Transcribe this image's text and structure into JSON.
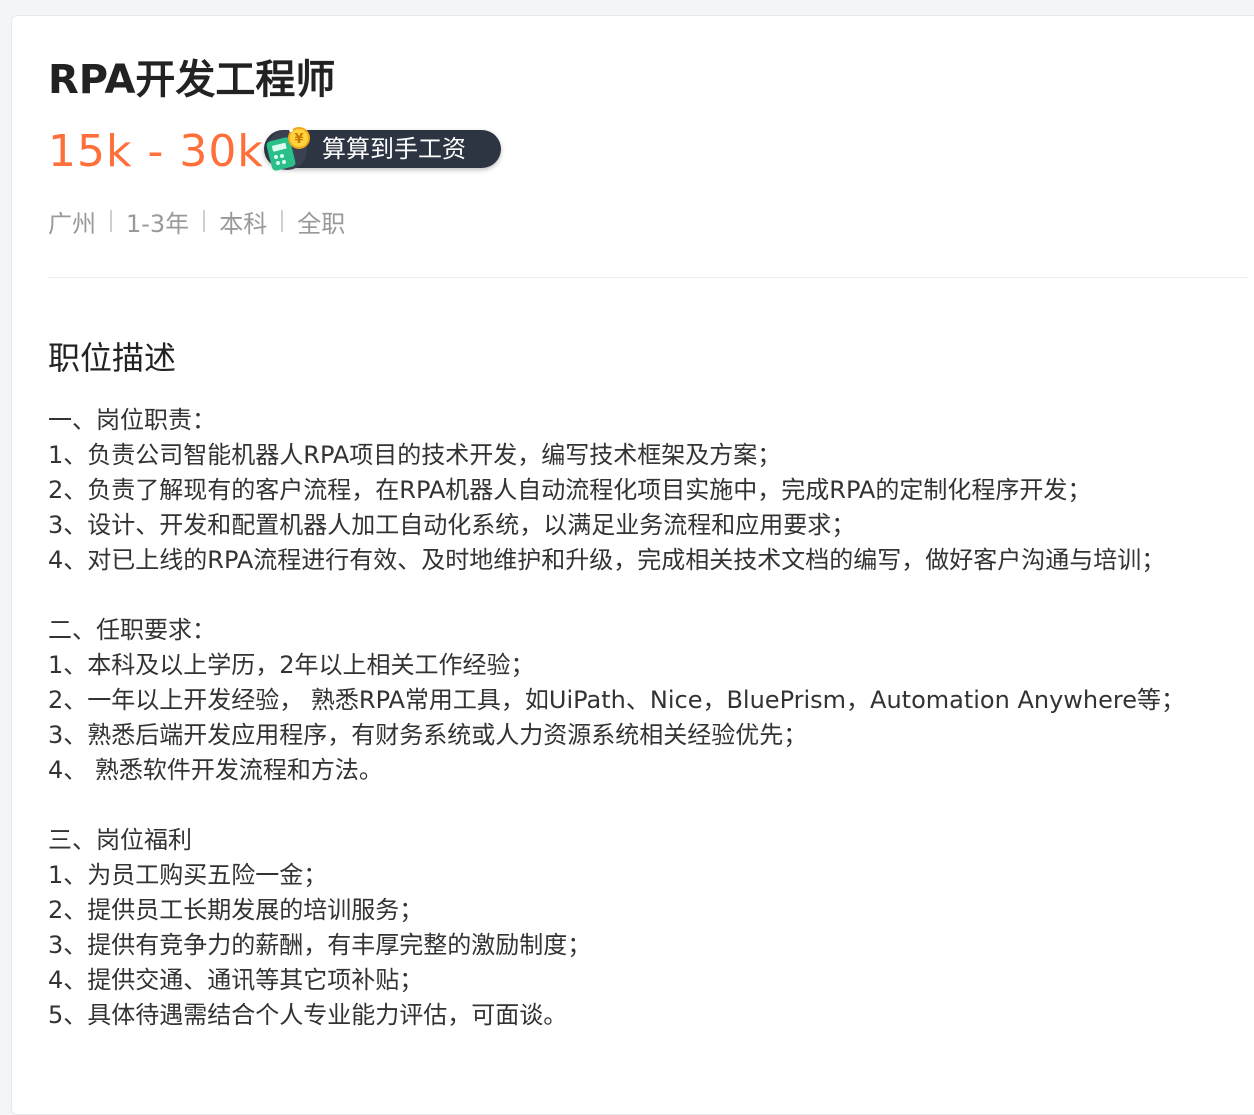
{
  "job": {
    "title": "RPA开发工程师",
    "salary": "15k - 30k",
    "calc_button_label": "算算到手工资",
    "meta": {
      "city": "广州",
      "experience": "1-3年",
      "education": "本科",
      "job_type": "全职"
    }
  },
  "description": {
    "heading": "职位描述",
    "lines": [
      "一、岗位职责：",
      "1、负责公司智能机器人RPA项目的技术开发，编写技术框架及方案；",
      "2、负责了解现有的客户流程，在RPA机器人自动流程化项目实施中，完成RPA的定制化程序开发；",
      "3、设计、开发和配置机器人加工自动化系统，以满足业务流程和应用要求；",
      "4、对已上线的RPA流程进行有效、及时地维护和升级，完成相关技术文档的编写，做好客户沟通与培训；",
      "",
      "二、任职要求：",
      "1、本科及以上学历，2年以上相关工作经验；",
      "2、一年以上开发经验， 熟悉RPA常用工具，如UiPath、Nice，BluePrism，Automation Anywhere等；",
      "3、熟悉后端开发应用程序，有财务系统或人力资源系统相关经验优先；",
      "4、 熟悉软件开发流程和方法。",
      "",
      "三、岗位福利",
      "1、为员工购买五险一金；",
      "2、提供员工长期发展的培训服务；",
      "3、提供有竞争力的薪酬，有丰厚完整的激励制度；",
      "4、提供交通、通讯等其它项补贴；",
      "5、具体待遇需结合个人专业能力评估，可面谈。"
    ]
  },
  "colors": {
    "salary": "#fe6f3a",
    "badge_background": "#2e3542",
    "title": "#222222",
    "meta_text": "#999999",
    "body_text": "#333333"
  },
  "icons": {
    "calc_badge_icon": "money-calculator-icon"
  }
}
